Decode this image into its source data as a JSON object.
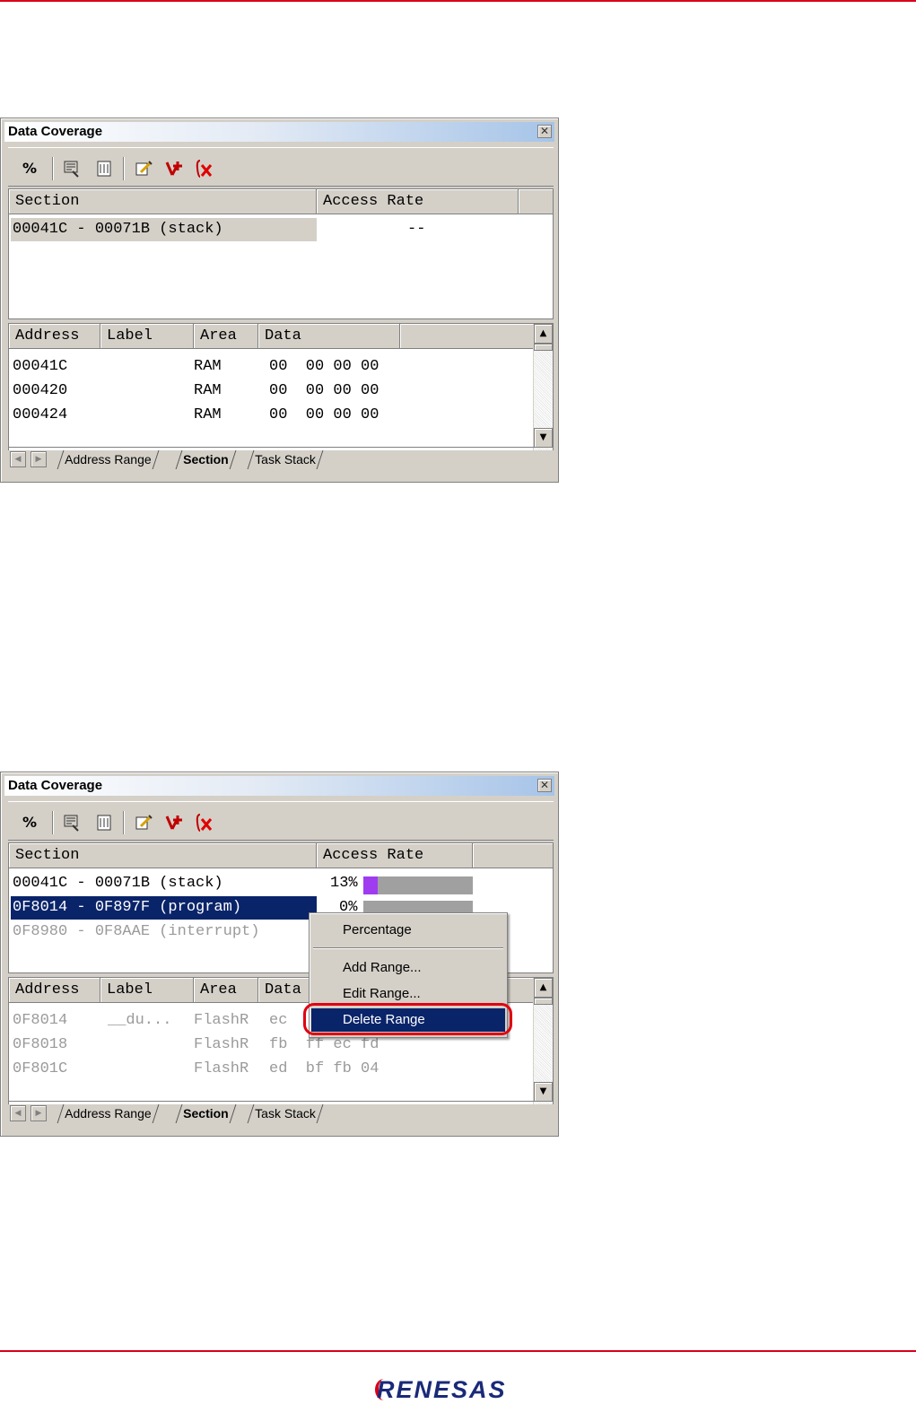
{
  "window1": {
    "title": "Data Coverage",
    "close_glyph": "✕",
    "toolbar": {
      "percent_label": "%"
    },
    "section_table": {
      "headers": [
        "Section",
        "Access Rate"
      ],
      "rows": [
        {
          "section": "00041C - 00071B (stack)",
          "rate": "--"
        }
      ]
    },
    "data_table": {
      "headers": [
        "Address",
        "Label",
        "Area",
        "Data"
      ],
      "rows": [
        {
          "address": "00041C",
          "label": "",
          "area": "RAM",
          "data": "00  00 00 00"
        },
        {
          "address": "000420",
          "label": "",
          "area": "RAM",
          "data": "00  00 00 00"
        },
        {
          "address": "000424",
          "label": "",
          "area": "RAM",
          "data": "00  00 00 00"
        }
      ]
    },
    "tabs": [
      "Address Range",
      "Section",
      "Task Stack"
    ],
    "active_tab": "Section"
  },
  "window2": {
    "title": "Data Coverage",
    "close_glyph": "✕",
    "toolbar": {
      "percent_label": "%"
    },
    "section_table": {
      "headers": [
        "Section",
        "Access Rate"
      ],
      "rows": [
        {
          "section": "00041C - 00071B (stack)",
          "rate": "13%",
          "fill": 0.13
        },
        {
          "section": "0F8014 - 0F897F (program)",
          "rate": "0%",
          "fill": 0
        },
        {
          "section": "0F8980 - 0F8AAE (interrupt)",
          "rate": "",
          "fill": 0
        }
      ]
    },
    "data_table": {
      "headers": [
        "Address",
        "Label",
        "Area",
        "Data"
      ],
      "rows": [
        {
          "address": "0F8014",
          "label": "__du...",
          "area": "FlashR",
          "data": "ec"
        },
        {
          "address": "0F8018",
          "label": "",
          "area": "FlashR",
          "data": "fb  ff ec fd"
        },
        {
          "address": "0F801C",
          "label": "",
          "area": "FlashR",
          "data": "ed  bf fb 04"
        }
      ]
    },
    "tabs": [
      "Address Range",
      "Section",
      "Task Stack"
    ],
    "active_tab": "Section",
    "bar_color": "#9f3cf0",
    "context_menu": [
      "Percentage",
      "Add Range...",
      "Edit Range...",
      "Delete Range"
    ],
    "highlighted_item": "Delete Range"
  },
  "logo_text": "RENESAS",
  "colors": {
    "accent_rule": "#d9001b",
    "selection": "#0a246a"
  }
}
